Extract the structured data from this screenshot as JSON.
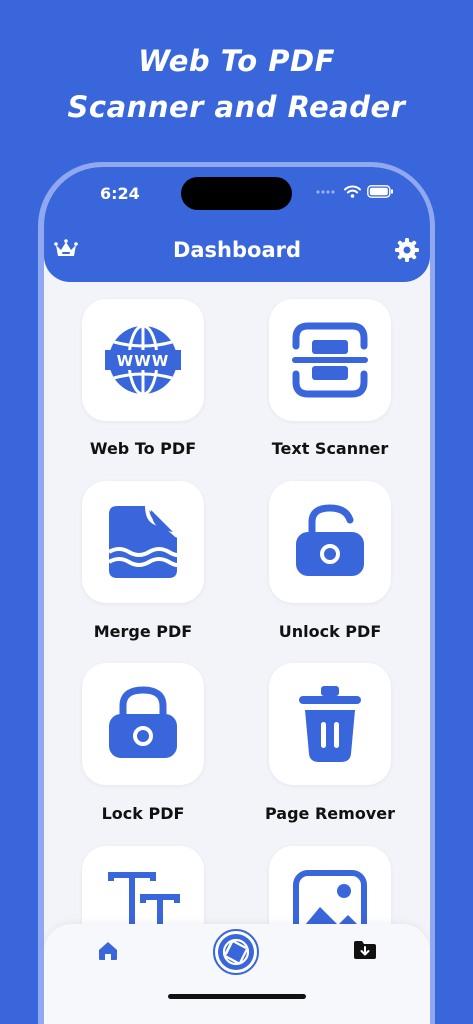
{
  "promo": {
    "line1": "Web To PDF",
    "line2": "Scanner and Reader"
  },
  "status": {
    "time": "6:24"
  },
  "header": {
    "title": "Dashboard"
  },
  "tiles": [
    {
      "label": "Web To PDF",
      "icon": "globe-www-icon"
    },
    {
      "label": "Text Scanner",
      "icon": "text-scanner-icon"
    },
    {
      "label": "Merge PDF",
      "icon": "merge-document-icon"
    },
    {
      "label": "Unlock PDF",
      "icon": "unlock-icon"
    },
    {
      "label": "Lock PDF",
      "icon": "lock-icon"
    },
    {
      "label": "Page Remover",
      "icon": "trash-icon"
    },
    {
      "label": "",
      "icon": "text-tool-icon"
    },
    {
      "label": "",
      "icon": "image-icon"
    }
  ],
  "bottom_nav": [
    {
      "icon": "home-icon"
    },
    {
      "icon": "camera-aperture-icon"
    },
    {
      "icon": "folder-download-icon"
    }
  ],
  "colors": {
    "accent": "#3a66dc",
    "phone_frame": "#8fa8ef",
    "screen_bg": "#f2f4f9"
  }
}
